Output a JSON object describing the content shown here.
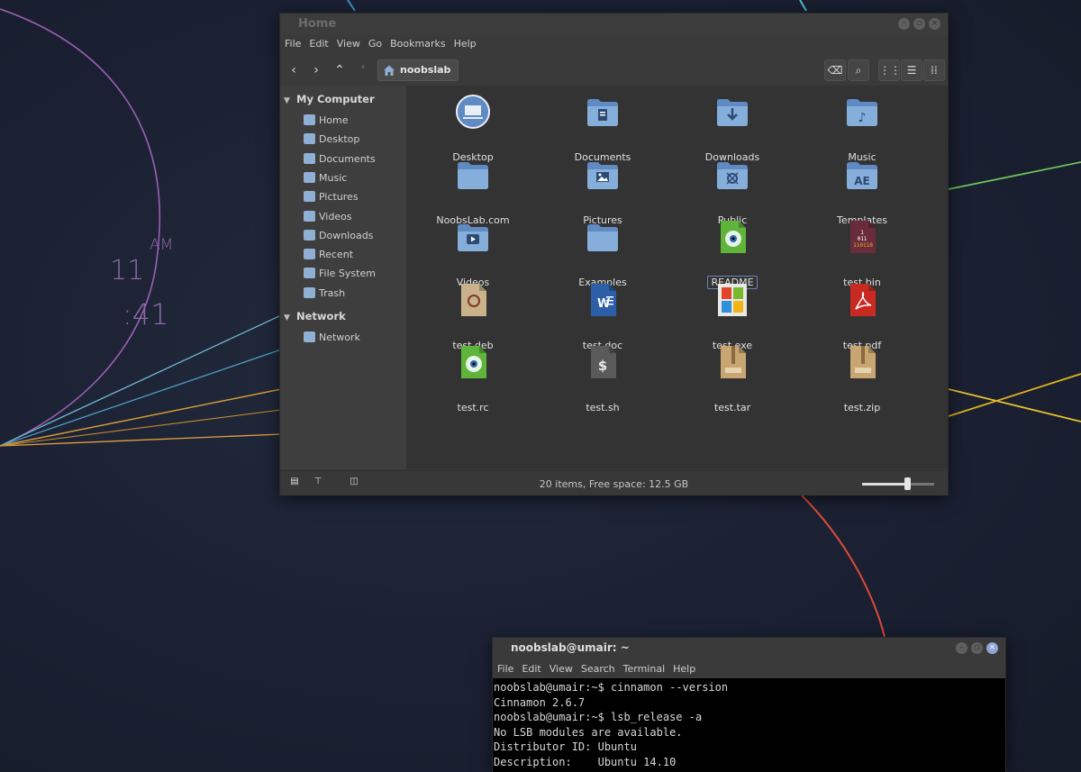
{
  "desktop": {
    "clock": {
      "hour": "11",
      "minute": ":41",
      "ampm": "AM"
    }
  },
  "file_manager": {
    "title": "Home",
    "menu": [
      "File",
      "Edit",
      "View",
      "Go",
      "Bookmarks",
      "Help"
    ],
    "path": {
      "current": "noobslab"
    },
    "sidebar": {
      "sections": [
        {
          "header": "My Computer",
          "items": [
            {
              "label": "Home",
              "icon": "home-icon"
            },
            {
              "label": "Desktop",
              "icon": "desktop-icon"
            },
            {
              "label": "Documents",
              "icon": "documents-icon"
            },
            {
              "label": "Music",
              "icon": "music-icon"
            },
            {
              "label": "Pictures",
              "icon": "pictures-icon"
            },
            {
              "label": "Videos",
              "icon": "videos-icon"
            },
            {
              "label": "Downloads",
              "icon": "downloads-icon"
            },
            {
              "label": "Recent",
              "icon": "recent-icon"
            },
            {
              "label": "File System",
              "icon": "drive-icon"
            },
            {
              "label": "Trash",
              "icon": "trash-icon"
            }
          ]
        },
        {
          "header": "Network",
          "items": [
            {
              "label": "Network",
              "icon": "network-icon"
            }
          ]
        }
      ]
    },
    "files": [
      {
        "label": "Desktop",
        "icon": "desktop-folder-icon"
      },
      {
        "label": "Documents",
        "icon": "documents-folder-icon"
      },
      {
        "label": "Downloads",
        "icon": "downloads-folder-icon"
      },
      {
        "label": "Music",
        "icon": "music-folder-icon"
      },
      {
        "label": "NoobsLab.com",
        "icon": "folder-icon"
      },
      {
        "label": "Pictures",
        "icon": "pictures-folder-icon"
      },
      {
        "label": "Public",
        "icon": "public-folder-icon"
      },
      {
        "label": "Templates",
        "icon": "templates-folder-icon"
      },
      {
        "label": "Videos",
        "icon": "videos-folder-icon"
      },
      {
        "label": "Examples",
        "icon": "folder-icon"
      },
      {
        "label": "README",
        "icon": "text-file-icon",
        "selected": true
      },
      {
        "label": "test.bin",
        "icon": "binary-file-icon"
      },
      {
        "label": "test.deb",
        "icon": "deb-package-icon"
      },
      {
        "label": "test.doc",
        "icon": "word-document-icon"
      },
      {
        "label": "test.exe",
        "icon": "exe-file-icon"
      },
      {
        "label": "test.pdf",
        "icon": "pdf-file-icon"
      },
      {
        "label": "test.rc",
        "icon": "text-file-icon"
      },
      {
        "label": "test.sh",
        "icon": "shell-script-icon"
      },
      {
        "label": "test.tar",
        "icon": "archive-file-icon"
      },
      {
        "label": "test.zip",
        "icon": "archive-file-icon"
      }
    ],
    "status": "20 items, Free space: 12.5 GB",
    "zoom_level": 0.62
  },
  "terminal": {
    "title": "noobslab@umair: ~",
    "menu": [
      "File",
      "Edit",
      "View",
      "Search",
      "Terminal",
      "Help"
    ],
    "lines": [
      "noobslab@umair:~$ cinnamon --version",
      "Cinnamon 2.6.7",
      "noobslab@umair:~$ lsb_release -a",
      "No LSB modules are available.",
      "Distributor ID: Ubuntu",
      "Description:    Ubuntu 14.10"
    ]
  },
  "colors": {
    "folder_blue": "#7fa7d6",
    "window_bg": "#3a3a3a",
    "content_bg": "#333333",
    "terminal_bg": "#000000"
  }
}
